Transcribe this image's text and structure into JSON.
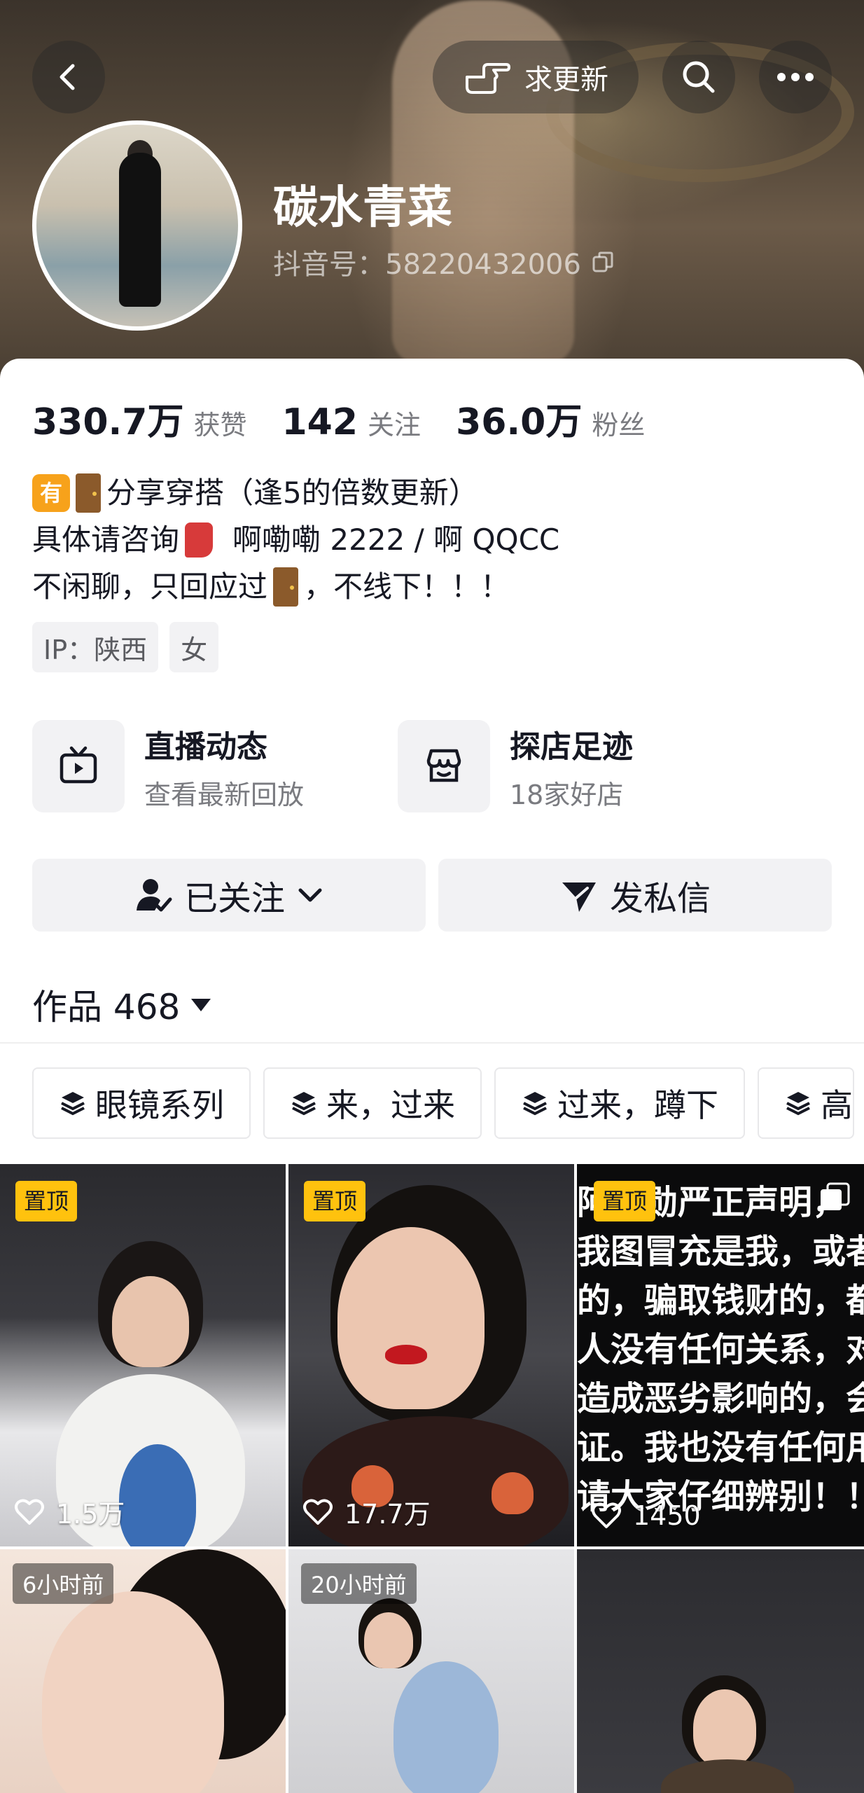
{
  "header": {
    "back_icon": "chevron-left-icon",
    "request_update_label": "求更新",
    "request_update_icon": "pointing-hand-icon",
    "search_icon": "search-icon",
    "more_icon": "more-dots-icon"
  },
  "profile": {
    "name": "碳水青菜",
    "douyin_id": "抖音号：58220432006",
    "copy_icon": "copy-icon"
  },
  "stats": [
    {
      "value": "330.7万",
      "label": "获赞"
    },
    {
      "value": "142",
      "label": "关注"
    },
    {
      "value": "36.0万",
      "label": "粉丝"
    }
  ],
  "bio": {
    "badge": "有",
    "line1": "分享穿搭（逢5的倍数更新）",
    "line2_a": "具体请咨询",
    "line2_b": "啊嘞嘞 2222 / 啊 QQCC",
    "line3_a": "不闲聊，只回应过",
    "line3_b": "，不线下！！！"
  },
  "chips": [
    "IP：陕西",
    "女"
  ],
  "features": [
    {
      "title": "直播动态",
      "subtitle": "查看最新回放",
      "icon": "tv-icon"
    },
    {
      "title": "探店足迹",
      "subtitle": "18家好店",
      "icon": "store-icon"
    }
  ],
  "actions": {
    "followed_label": "已关注",
    "message_label": "发私信"
  },
  "works": {
    "label": "作品 468"
  },
  "collections": [
    "眼镜系列",
    "来，过来",
    "过来，蹲下",
    "高"
  ],
  "videos": [
    {
      "badge": "置顶",
      "likes": "1.5万"
    },
    {
      "badge": "置顶",
      "likes": "17.7万"
    },
    {
      "badge": "置顶",
      "likes": "1450",
      "overlay_lines": [
        "阿某勋严正声明，",
        "我图冒充是我，或者",
        "的，骗取钱财的，都",
        "人没有任何关系，对",
        "造成恶劣影响的，会",
        "证。我也没有任何用",
        "请大家仔细辨别！！"
      ]
    },
    {
      "time": "6小时前"
    },
    {
      "time": "20小时前"
    },
    {}
  ],
  "colors": {
    "accent_yellow": "#ffc20e",
    "text_primary": "#161823",
    "text_secondary": "#7a7b80",
    "surface": "#f2f2f4"
  }
}
